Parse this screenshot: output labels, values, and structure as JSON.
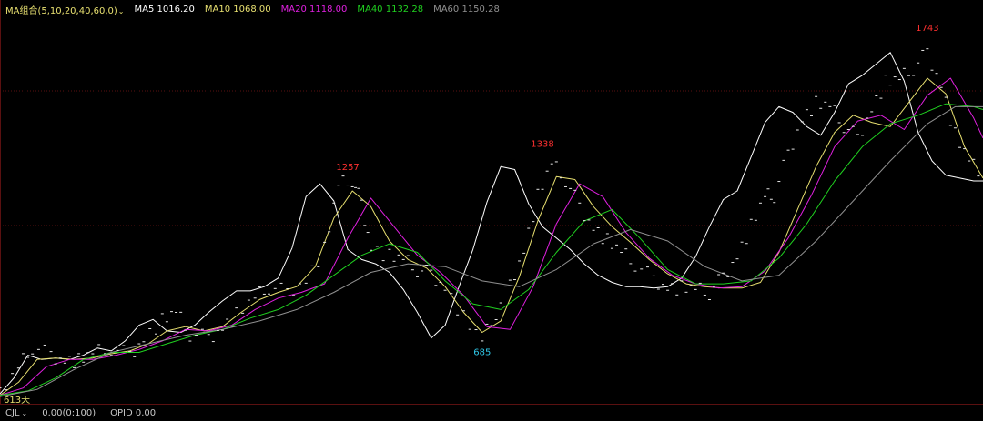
{
  "legend": {
    "group": "MA组合(5,10,20,40,60,0)",
    "chevron": "chevron-down-icon",
    "items": [
      {
        "label": "MA5 1016.20",
        "color": "#ffffff"
      },
      {
        "label": "MA10 1068.00",
        "color": "#e8e070"
      },
      {
        "label": "MA20 1118.00",
        "color": "#e020e0"
      },
      {
        "label": "MA40 1132.28",
        "color": "#20d020"
      },
      {
        "label": "MA60 1150.28",
        "color": "#909090"
      }
    ]
  },
  "days_label": "613天",
  "bottom": {
    "cjl": "CJL",
    "cjl_value": "0.00(0:100)",
    "opid": "OPID 0.00"
  },
  "colors": {
    "background": "#000000",
    "grid": "#5a1010",
    "peak": "#ff3030",
    "trough": "#30c8e8",
    "group_label": "#e8e070"
  },
  "chart_data": {
    "type": "line",
    "annotations": [
      {
        "text": "1257",
        "x": 75,
        "y": 1257,
        "kind": "high"
      },
      {
        "text": "1338",
        "x": 117,
        "y": 1338,
        "kind": "high"
      },
      {
        "text": "685",
        "x": 104,
        "y": 685,
        "kind": "low"
      },
      {
        "text": "1743",
        "x": 200,
        "y": 1743,
        "kind": "high"
      }
    ],
    "ylim": [
      470,
      1820
    ],
    "xlim": [
      0,
      212
    ],
    "grid": true,
    "price": {
      "x": [
        0,
        4,
        7,
        11,
        14,
        17,
        20,
        24,
        28,
        31,
        35,
        38,
        41,
        45,
        48,
        51,
        55,
        58,
        62,
        66,
        70,
        73,
        76,
        78,
        80,
        84,
        87,
        90,
        93,
        96,
        100,
        104,
        107,
        110,
        113,
        116,
        119,
        122,
        125,
        128,
        131,
        134,
        137,
        141,
        144,
        147,
        150,
        153,
        156,
        159,
        162,
        165,
        167,
        170,
        173,
        176,
        179,
        182,
        185,
        188,
        191,
        194,
        197,
        200,
        203,
        206,
        209,
        212
      ],
      "y": [
        500,
        595,
        670,
        640,
        625,
        620,
        645,
        665,
        640,
        700,
        760,
        790,
        715,
        700,
        740,
        780,
        840,
        880,
        860,
        905,
        1010,
        1235,
        1255,
        1170,
        1020,
        985,
        975,
        940,
        925,
        880,
        770,
        690,
        790,
        890,
        1010,
        1195,
        1310,
        1255,
        1160,
        1090,
        1040,
        1000,
        960,
        905,
        880,
        875,
        870,
        860,
        915,
        990,
        1090,
        1195,
        1200,
        1345,
        1470,
        1520,
        1510,
        1445,
        1400,
        1505,
        1595,
        1605,
        1645,
        1700,
        1590,
        1410,
        1320,
        1260
      ]
    },
    "series": [
      {
        "name": "MA5",
        "color": "#ffffff",
        "x": [
          0,
          3,
          6,
          9,
          12,
          15,
          18,
          21,
          24,
          27,
          30,
          33,
          36,
          39,
          42,
          45,
          48,
          51,
          54,
          57,
          60,
          63,
          66,
          69,
          72,
          75,
          78,
          81,
          84,
          87,
          90,
          93,
          96,
          99,
          102,
          105,
          108,
          111,
          114,
          117,
          120,
          123,
          126,
          129,
          132,
          135,
          138,
          141,
          144,
          147,
          150,
          153,
          156,
          159,
          162,
          165,
          168,
          171,
          174,
          177,
          180,
          183,
          186,
          189,
          192,
          195,
          198,
          201,
          204,
          207,
          210,
          212
        ],
        "y": [
          505,
          560,
          640,
          625,
          630,
          625,
          640,
          665,
          655,
          690,
          745,
          765,
          725,
          720,
          745,
          790,
          830,
          865,
          865,
          880,
          910,
          1015,
          1195,
          1240,
          1180,
          1010,
          975,
          960,
          930,
          870,
          790,
          700,
          745,
          880,
          1010,
          1175,
          1300,
          1290,
          1170,
          1090,
          1050,
          1010,
          960,
          920,
          895,
          880,
          880,
          875,
          880,
          910,
          985,
          1090,
          1185,
          1215,
          1335,
          1455,
          1510,
          1490,
          1440,
          1410,
          1490,
          1590,
          1620,
          1660,
          1700,
          1600,
          1420,
          1320,
          1270,
          1260,
          1250,
          1250
        ]
      },
      {
        "name": "MA10",
        "color": "#e8e070",
        "x": [
          0,
          4,
          8,
          12,
          16,
          20,
          24,
          28,
          32,
          36,
          40,
          44,
          48,
          52,
          56,
          60,
          64,
          68,
          72,
          76,
          80,
          84,
          88,
          92,
          96,
          100,
          104,
          108,
          112,
          116,
          120,
          124,
          128,
          132,
          136,
          140,
          144,
          148,
          152,
          156,
          160,
          164,
          168,
          172,
          176,
          180,
          184,
          188,
          192,
          196,
          200,
          204,
          208,
          212
        ],
        "y": [
          500,
          545,
          625,
          630,
          625,
          630,
          645,
          655,
          680,
          725,
          740,
          725,
          740,
          790,
          835,
          860,
          880,
          950,
          1120,
          1215,
          1160,
          1040,
          975,
          945,
          880,
          790,
          720,
          760,
          915,
          1110,
          1265,
          1255,
          1160,
          1090,
          1035,
          975,
          925,
          890,
          880,
          875,
          875,
          895,
          1000,
          1150,
          1300,
          1420,
          1480,
          1455,
          1440,
          1525,
          1610,
          1555,
          1370,
          1260
        ]
      },
      {
        "name": "MA20",
        "color": "#e020e0",
        "x": [
          0,
          5,
          10,
          15,
          20,
          25,
          30,
          35,
          40,
          45,
          50,
          55,
          60,
          65,
          70,
          75,
          80,
          85,
          90,
          95,
          100,
          105,
          110,
          115,
          120,
          125,
          130,
          135,
          140,
          145,
          150,
          155,
          160,
          165,
          170,
          175,
          180,
          185,
          190,
          195,
          200,
          205,
          210,
          212
        ],
        "y": [
          500,
          525,
          600,
          625,
          625,
          640,
          660,
          690,
          730,
          725,
          745,
          800,
          840,
          860,
          890,
          1050,
          1190,
          1090,
          990,
          930,
          850,
          740,
          730,
          880,
          1100,
          1240,
          1195,
          1070,
          980,
          920,
          890,
          875,
          880,
          935,
          1050,
          1200,
          1370,
          1460,
          1480,
          1430,
          1550,
          1610,
          1470,
          1400
        ]
      },
      {
        "name": "MA40",
        "color": "#20d020",
        "x": [
          0,
          6,
          12,
          18,
          24,
          30,
          36,
          42,
          48,
          54,
          60,
          66,
          72,
          78,
          84,
          90,
          96,
          102,
          108,
          114,
          120,
          126,
          132,
          138,
          144,
          150,
          156,
          162,
          168,
          174,
          180,
          186,
          192,
          198,
          204,
          210,
          212
        ],
        "y": [
          500,
          515,
          560,
          625,
          650,
          650,
          680,
          710,
          730,
          770,
          800,
          850,
          920,
          990,
          1030,
          1000,
          900,
          820,
          800,
          870,
          1000,
          1110,
          1150,
          1050,
          940,
          890,
          890,
          900,
          980,
          1100,
          1250,
          1370,
          1450,
          1480,
          1520,
          1510,
          1500
        ]
      },
      {
        "name": "MA60",
        "color": "#909090",
        "x": [
          0,
          8,
          16,
          24,
          32,
          40,
          48,
          56,
          64,
          72,
          80,
          88,
          96,
          104,
          112,
          120,
          128,
          136,
          144,
          152,
          160,
          168,
          176,
          184,
          192,
          200,
          206,
          212
        ],
        "y": [
          495,
          520,
          590,
          650,
          680,
          710,
          730,
          760,
          800,
          860,
          930,
          960,
          950,
          900,
          880,
          940,
          1030,
          1080,
          1040,
          950,
          900,
          920,
          1040,
          1180,
          1320,
          1450,
          1510,
          1510
        ]
      }
    ]
  }
}
